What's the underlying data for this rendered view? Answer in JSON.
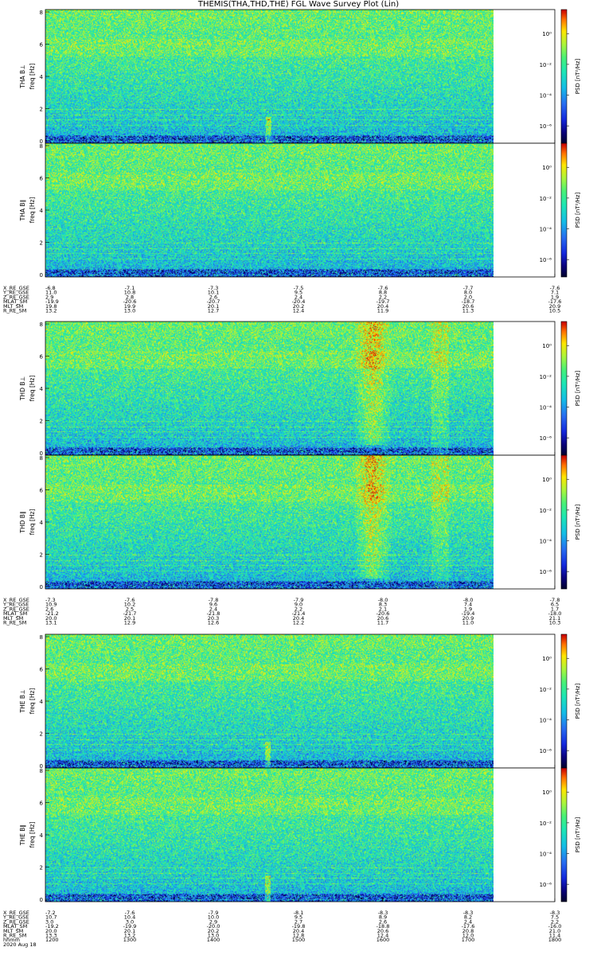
{
  "title": "THEMIS(THA,THD,THE) FGL Wave Survey Plot (Lin)",
  "chart_data": {
    "type": "heatmap",
    "title": "THEMIS(THA,THD,THE) FGL Wave Survey Plot (Lin)",
    "colorbar": {
      "label": "PSD [nT²/Hz]",
      "scale": "log",
      "ticks": [
        "10⁰",
        "10⁻²",
        "10⁻⁴",
        "10⁻⁶"
      ]
    },
    "freq_ticks": [
      "0",
      "2",
      "4",
      "6",
      "8"
    ],
    "ylim": [
      0,
      8
    ],
    "ephemeris_row_labels": [
      "X_RE_GSE",
      "Y_RE_GSE",
      "Z_RE_GSE",
      "MLAT_SM",
      "MLT_SM",
      "R_RE_SM"
    ],
    "time_axis": {
      "row_label": "hhmm",
      "date": "2020 Aug 18",
      "ticks": [
        "1200",
        "1300",
        "1400",
        "1500",
        "1600",
        "1700",
        "1800"
      ]
    },
    "probes": [
      {
        "name": "THA",
        "panels": [
          {
            "ylabel": "THA B⊥",
            "ylabel2": "freq [Hz]",
            "feature": "spike",
            "spike_x": 0.498
          },
          {
            "ylabel": "THA B∥",
            "ylabel2": "freq [Hz]",
            "feature": "none",
            "spike_x": 0.498
          }
        ],
        "ephemeris": [
          [
            "-6.8",
            "-7.1",
            "-7.3",
            "-7.5",
            "-7.6",
            "-7.7",
            "-7.6"
          ],
          [
            "11.0",
            "10.8",
            "10.1",
            "9.5",
            "8.8",
            "8.0",
            "7.1"
          ],
          [
            "2.9",
            "2.8",
            "2.6",
            "2.4",
            "2.2",
            "2.0",
            "1.9"
          ],
          [
            "-19.9",
            "-20.6",
            "-20.7",
            "-20.4",
            "-19.7",
            "-18.7",
            "-17.6"
          ],
          [
            "19.8",
            "19.9",
            "20.1",
            "20.2",
            "20.4",
            "20.6",
            "20.9"
          ],
          [
            "13.2",
            "13.0",
            "12.7",
            "12.4",
            "11.9",
            "11.3",
            "10.5"
          ]
        ]
      },
      {
        "name": "THD",
        "panels": [
          {
            "ylabel": "THD B⊥",
            "ylabel2": "freq [Hz]",
            "feature": "burst"
          },
          {
            "ylabel": "THD B∥",
            "ylabel2": "freq [Hz]",
            "feature": "burst"
          }
        ],
        "ephemeris": [
          [
            "-7.3",
            "-7.6",
            "-7.8",
            "-7.9",
            "-8.0",
            "-8.0",
            "-7.8"
          ],
          [
            "10.9",
            "10.2",
            "9.6",
            "9.0",
            "8.3",
            "7.4",
            "6.5"
          ],
          [
            "2.6",
            "2.5",
            "2.4",
            "2.2",
            "2.1",
            "1.9",
            "1.7"
          ],
          [
            "-21.2",
            "-21.7",
            "-21.8",
            "-21.4",
            "-20.6",
            "-19.4",
            "-18.0"
          ],
          [
            "20.0",
            "20.1",
            "20.3",
            "20.4",
            "20.6",
            "20.9",
            "21.1"
          ],
          [
            "13.1",
            "12.9",
            "12.6",
            "12.2",
            "11.7",
            "11.0",
            "10.3"
          ]
        ]
      },
      {
        "name": "THE",
        "panels": [
          {
            "ylabel": "THE B⊥",
            "ylabel2": "freq [Hz]",
            "feature": "spike",
            "spike_x": 0.495
          },
          {
            "ylabel": "THE B∥",
            "ylabel2": "freq [Hz]",
            "feature": "spike",
            "spike_x": 0.495
          }
        ],
        "ephemeris": [
          [
            "-7.2",
            "-7.6",
            "-7.9",
            "-8.1",
            "-8.3",
            "-8.3",
            "-8.3"
          ],
          [
            "10.7",
            "10.4",
            "10.0",
            "9.5",
            "8.9",
            "8.2",
            "7.5"
          ],
          [
            "3.0",
            "3.0",
            "2.9",
            "2.7",
            "2.6",
            "2.4",
            "2.2"
          ],
          [
            "-19.2",
            "-19.9",
            "-20.0",
            "-19.8",
            "-18.8",
            "-17.6",
            "-16.0"
          ],
          [
            "20.0",
            "20.1",
            "20.2",
            "20.4",
            "20.6",
            "20.8",
            "21.0"
          ],
          [
            "13.3",
            "13.2",
            "13.0",
            "12.8",
            "12.4",
            "12.0",
            "11.4"
          ]
        ]
      }
    ]
  }
}
